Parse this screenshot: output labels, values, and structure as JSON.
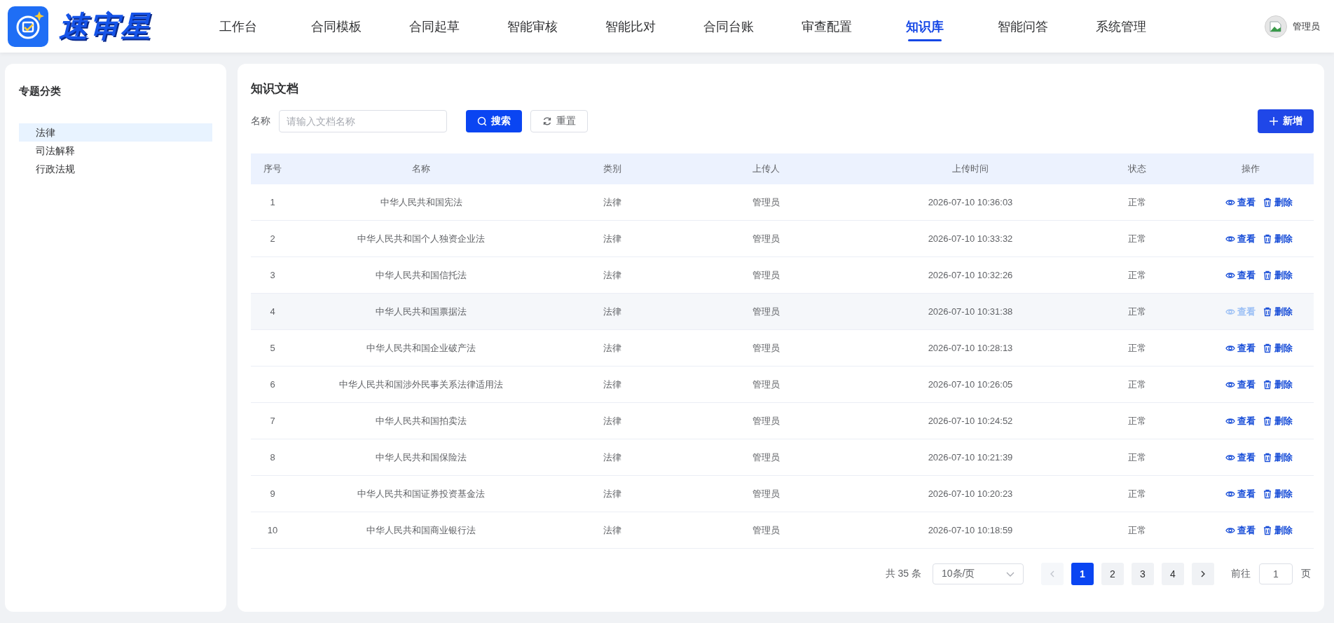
{
  "header": {
    "brand": "速审星",
    "nav": [
      {
        "label": "工作台",
        "selected": false
      },
      {
        "label": "合同模板",
        "selected": false
      },
      {
        "label": "合同起草",
        "selected": false
      },
      {
        "label": "智能审核",
        "selected": false
      },
      {
        "label": "智能比对",
        "selected": false
      },
      {
        "label": "合同台账",
        "selected": false
      },
      {
        "label": "审查配置",
        "selected": false
      },
      {
        "label": "知识库",
        "selected": true
      },
      {
        "label": "智能问答",
        "selected": false
      },
      {
        "label": "系统管理",
        "selected": false
      }
    ],
    "user": "管理员"
  },
  "sidebar": {
    "title": "专题分类",
    "items": [
      {
        "label": "法律",
        "selected": true
      },
      {
        "label": "司法解释",
        "selected": false
      },
      {
        "label": "行政法规",
        "selected": false
      }
    ]
  },
  "panel": {
    "title": "知识文档",
    "filter_label": "名称",
    "search": {
      "placeholder": "请输入文档名称"
    },
    "search_button": "搜索",
    "reset_button": "重置",
    "add_button": "新增"
  },
  "table": {
    "columns": [
      "序号",
      "名称",
      "类别",
      "上传人",
      "上传时间",
      "状态",
      "操作"
    ],
    "rows": [
      {
        "cells": [
          "1",
          "中华人民共和国宪法",
          "法律",
          "管理员",
          "2026-07-10 10:36:03",
          "正常"
        ],
        "actions": [
          "查看",
          "删除"
        ],
        "hovered": false
      },
      {
        "cells": [
          "2",
          "中华人民共和国个人独资企业法",
          "法律",
          "管理员",
          "2026-07-10 10:33:32",
          "正常"
        ],
        "actions": [
          "查看",
          "删除"
        ],
        "hovered": false
      },
      {
        "cells": [
          "3",
          "中华人民共和国信托法",
          "法律",
          "管理员",
          "2026-07-10 10:32:26",
          "正常"
        ],
        "actions": [
          "查看",
          "删除"
        ],
        "hovered": false
      },
      {
        "cells": [
          "4",
          "中华人民共和国票据法",
          "法律",
          "管理员",
          "2026-07-10 10:31:38",
          "正常"
        ],
        "actions": [
          "查看",
          "删除"
        ],
        "hovered": true
      },
      {
        "cells": [
          "5",
          "中华人民共和国企业破产法",
          "法律",
          "管理员",
          "2026-07-10 10:28:13",
          "正常"
        ],
        "actions": [
          "查看",
          "删除"
        ],
        "hovered": false
      },
      {
        "cells": [
          "6",
          "中华人民共和国涉外民事关系法律适用法",
          "法律",
          "管理员",
          "2026-07-10 10:26:05",
          "正常"
        ],
        "actions": [
          "查看",
          "删除"
        ],
        "hovered": false
      },
      {
        "cells": [
          "7",
          "中华人民共和国拍卖法",
          "法律",
          "管理员",
          "2026-07-10 10:24:52",
          "正常"
        ],
        "actions": [
          "查看",
          "删除"
        ],
        "hovered": false
      },
      {
        "cells": [
          "8",
          "中华人民共和国保险法",
          "法律",
          "管理员",
          "2026-07-10 10:21:39",
          "正常"
        ],
        "actions": [
          "查看",
          "删除"
        ],
        "hovered": false
      },
      {
        "cells": [
          "9",
          "中华人民共和国证券投资基金法",
          "法律",
          "管理员",
          "2026-07-10 10:20:23",
          "正常"
        ],
        "actions": [
          "查看",
          "删除"
        ],
        "hovered": false
      },
      {
        "cells": [
          "10",
          "中华人民共和国商业银行法",
          "法律",
          "管理员",
          "2026-07-10 10:18:59",
          "正常"
        ],
        "actions": [
          "查看",
          "删除"
        ],
        "hovered": false
      }
    ]
  },
  "pagination": {
    "total": "共 35 条",
    "page_size": "10条/页",
    "prev_disabled": true,
    "pages": [
      {
        "label": "1",
        "selected": true
      },
      {
        "label": "2",
        "selected": false
      },
      {
        "label": "3",
        "selected": false
      },
      {
        "label": "4",
        "selected": false
      }
    ],
    "goto_label": "前往",
    "goto_value": "1",
    "page_suffix": "页"
  }
}
